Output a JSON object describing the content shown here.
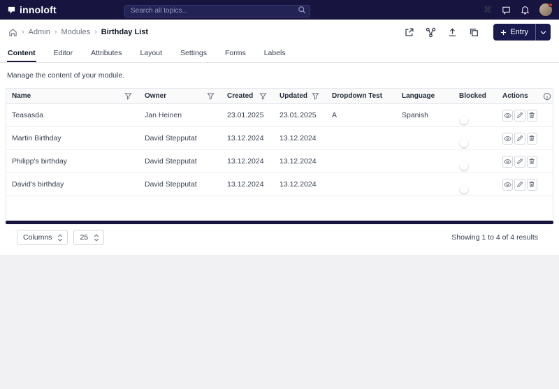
{
  "colors": {
    "brand_navy": "#17153f",
    "button_navy": "#1b1a4e",
    "alert_red": "#e0311f"
  },
  "topbar": {
    "logo_text": "innoloft",
    "search_placeholder": "Search all topics...",
    "command_glyph": "⌘"
  },
  "breadcrumb": {
    "separator": "›",
    "items": [
      "Admin",
      "Modules",
      "Birthday List"
    ]
  },
  "toolbar": {
    "entry_button_label": "Entry"
  },
  "tabs": [
    {
      "label": "Content"
    },
    {
      "label": "Editor"
    },
    {
      "label": "Attributes"
    },
    {
      "label": "Layout"
    },
    {
      "label": "Settings"
    },
    {
      "label": "Forms"
    },
    {
      "label": "Labels"
    }
  ],
  "page": {
    "subtitle": "Manage the content of your module."
  },
  "table": {
    "columns": {
      "name": "Name",
      "owner": "Owner",
      "created": "Created",
      "updated": "Updated",
      "dropdown_test": "Dropdown Test",
      "language": "Language",
      "blocked": "Blocked",
      "actions": "Actions"
    },
    "rows": [
      {
        "name": "Teasasda",
        "owner": "Jan Heinen",
        "created": "23.01.2025",
        "updated": "23.01.2025",
        "dropdown_test": "A",
        "language": "Spanish",
        "blocked": false
      },
      {
        "name": "Martin Birthday",
        "owner": "David Stepputat",
        "created": "13.12.2024",
        "updated": "13.12.2024",
        "dropdown_test": "",
        "language": "",
        "blocked": false
      },
      {
        "name": "Philipp's birthday",
        "owner": "David Stepputat",
        "created": "13.12.2024",
        "updated": "13.12.2024",
        "dropdown_test": "",
        "language": "",
        "blocked": false
      },
      {
        "name": "David's birthday",
        "owner": "David Stepputat",
        "created": "13.12.2024",
        "updated": "13.12.2024",
        "dropdown_test": "",
        "language": "",
        "blocked": false
      }
    ]
  },
  "footer": {
    "columns_select_label": "Columns",
    "page_size_value": "25",
    "results_text": "Showing 1 to 4 of 4 results"
  }
}
